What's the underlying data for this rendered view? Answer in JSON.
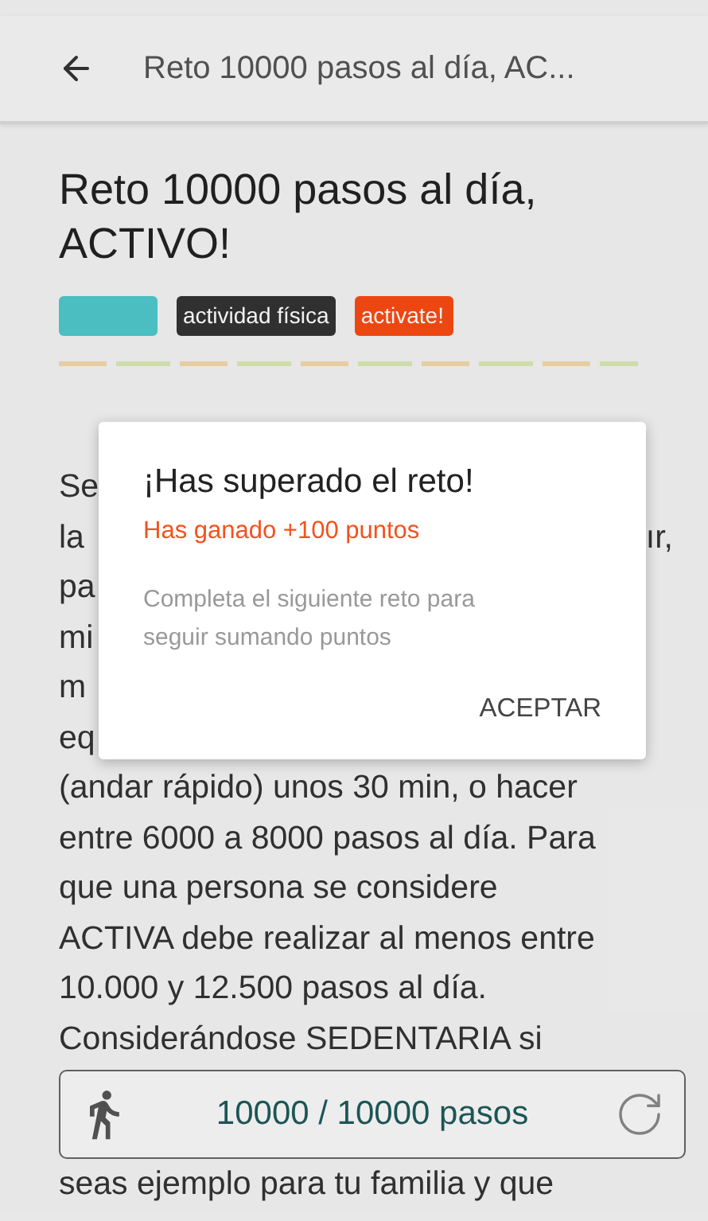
{
  "header": {
    "title": "Reto 10000 pasos al día, AC..."
  },
  "challenge": {
    "title": "Reto 10000 pasos al día, ACTIVO!",
    "tags": [
      {
        "color": "#4fc9cc"
      },
      {
        "label": "actividad física",
        "color": "#333333"
      },
      {
        "label": "activate!",
        "color": "#fa4b12"
      }
    ],
    "body_lines": [
      {
        "start": "Se"
      },
      {
        "start": "la",
        "end": "ır,"
      },
      {
        "start": "pa"
      },
      {
        "start": "mi"
      },
      {
        "start": "m"
      },
      {
        "start": "eq"
      },
      {
        "start": "(andar rápido) unos 30 min, o hacer"
      },
      {
        "start": "entre 6000 a 8000 pasos al día. Para"
      },
      {
        "start": "que una persona se considere"
      },
      {
        "start": "ACTIVA debe realizar al menos entre"
      },
      {
        "start": "10.000 y 12.500 pasos al día."
      },
      {
        "start": "Considerándose SEDENTARIA si"
      }
    ],
    "steps": {
      "reading": "10000 / 10000 pasos"
    },
    "after_lines": [
      {
        "start": "seas ejemplo para tu familia y que"
      }
    ]
  },
  "dialog": {
    "title": "¡Has superado el reto!",
    "points": "Has ganado +100 puntos",
    "message": "Completa el siguiente reto para seguir sumando puntos",
    "button": "ACEPTAR"
  }
}
